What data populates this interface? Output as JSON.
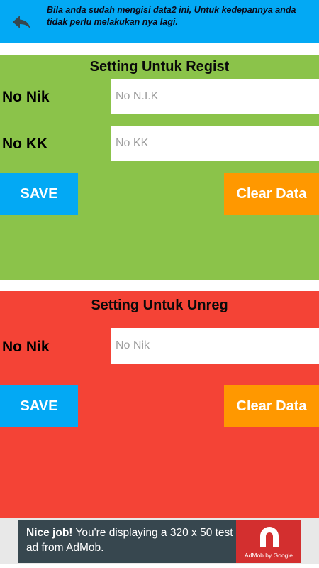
{
  "header": {
    "back_icon": "back-arrow-icon",
    "info_text": "Bila anda sudah mengisi data2 ini, Untuk kedepannya anda tidak perlu melakukan nya lagi."
  },
  "regist": {
    "title": "Setting Untuk Regist",
    "nik_label": "No Nik",
    "nik_placeholder": "No N.I.K",
    "kk_label": "No KK",
    "kk_placeholder": "No KK",
    "save_label": "SAVE",
    "clear_label": "Clear Data"
  },
  "unreg": {
    "title": "Setting Untuk Unreg",
    "nik_label": "No Nik",
    "nik_placeholder": "No Nik",
    "save_label": "SAVE",
    "clear_label": "Clear Data"
  },
  "ad": {
    "headline": "Nice job!",
    "body": "You're displaying a 320 x 50 test ad from AdMob.",
    "brand": "AdMob by Google",
    "logo_icon": "admob-logo-icon"
  },
  "colors": {
    "header": "#03A9F4",
    "regist_bg": "#8BC34A",
    "unreg_bg": "#F44336",
    "save_button": "#03A9F4",
    "clear_button": "#FF9800",
    "ad_bg": "#37474F",
    "ad_logo_bg": "#D32F2F"
  }
}
